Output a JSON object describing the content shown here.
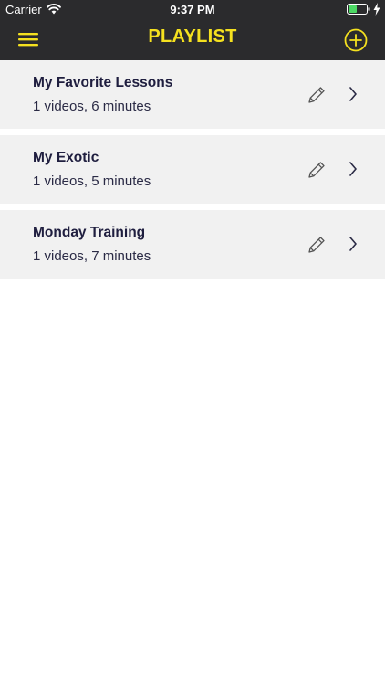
{
  "status_bar": {
    "carrier": "Carrier",
    "time": "9:37 PM",
    "battery_color": "#4cd964"
  },
  "nav": {
    "title": "PLAYLIST",
    "menu_icon": "hamburger-menu-icon",
    "add_icon": "plus-circle-icon",
    "accent_color": "#f5e11f",
    "background_color": "#2b2b2d"
  },
  "playlists": [
    {
      "title": "My Favorite Lessons",
      "subtitle": "1 videos, 6 minutes"
    },
    {
      "title": "My Exotic",
      "subtitle": "1 videos, 5 minutes"
    },
    {
      "title": "Monday Training",
      "subtitle": "1 videos, 7 minutes"
    }
  ],
  "row_icons": {
    "edit": "pencil-icon",
    "open": "chevron-right-icon"
  }
}
